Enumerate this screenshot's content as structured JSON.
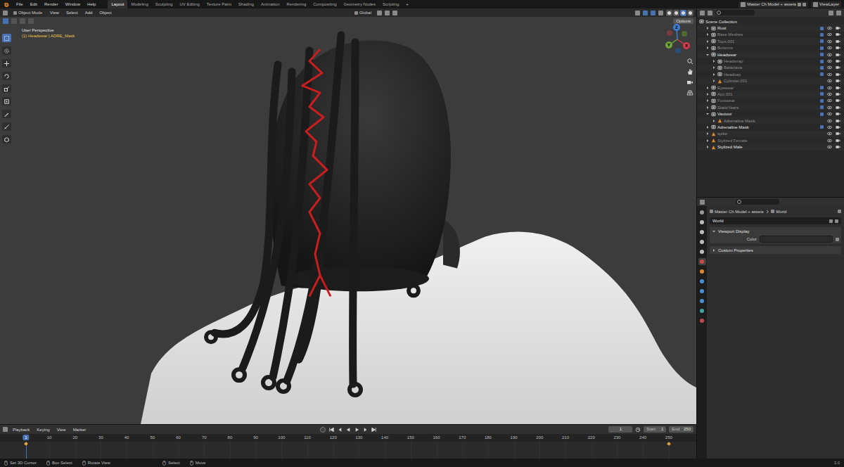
{
  "topbar": {
    "menu": [
      "File",
      "Edit",
      "Render",
      "Window",
      "Help"
    ],
    "workspaces": [
      {
        "label": "Layout",
        "selected": true
      },
      {
        "label": "Modeling",
        "selected": false
      },
      {
        "label": "Sculpting",
        "selected": false
      },
      {
        "label": "UV Editing",
        "selected": false
      },
      {
        "label": "Texture Paint",
        "selected": false
      },
      {
        "label": "Shading",
        "selected": false
      },
      {
        "label": "Animation",
        "selected": false
      },
      {
        "label": "Rendering",
        "selected": false
      },
      {
        "label": "Compositing",
        "selected": false
      },
      {
        "label": "Geometry Nodes",
        "selected": false
      },
      {
        "label": "Scripting",
        "selected": false
      }
    ],
    "add_workspace": "+",
    "scene": "Master Ch Model + assets",
    "view_layer": "ViewLayer"
  },
  "viewport": {
    "mode": "Object Mode",
    "menu": [
      "View",
      "Select",
      "Add",
      "Object"
    ],
    "orientation": "Global",
    "options": "Options",
    "select_modes": [
      {
        "selected": true
      },
      {
        "selected": false
      },
      {
        "selected": false
      },
      {
        "selected": false
      }
    ],
    "tools": [
      {
        "selected": true
      },
      {
        "selected": false
      },
      {
        "selected": false
      },
      {
        "selected": false
      },
      {
        "selected": false
      },
      {
        "selected": false
      },
      {
        "selected": false
      },
      {
        "selected": false
      },
      {
        "selected": false
      }
    ],
    "perspective": "User Perspective",
    "object_info": "(1) Headwear | ADRE_Mask",
    "gizmo": {
      "x": "X",
      "y": "Y",
      "z": "Z"
    },
    "shading": [
      {
        "selected": false
      },
      {
        "selected": false
      },
      {
        "selected": true
      },
      {
        "selected": false
      }
    ]
  },
  "outliner": {
    "items": [
      {
        "name": "Scene Collection",
        "kind": "scene",
        "expanded": true,
        "dimmed": false,
        "children": [
          {
            "name": "Rust",
            "kind": "collection",
            "expanded": false,
            "dimmed": false,
            "checked": true,
            "visible": true,
            "children": []
          },
          {
            "name": "Base Meshes",
            "kind": "collection",
            "expanded": false,
            "dimmed": true,
            "checked": true,
            "visible": true,
            "children": []
          },
          {
            "name": "Tops.001",
            "kind": "collection",
            "expanded": false,
            "dimmed": true,
            "checked": true,
            "visible": true,
            "children": []
          },
          {
            "name": "Bottoms",
            "kind": "collection",
            "expanded": false,
            "dimmed": true,
            "checked": true,
            "visible": true,
            "children": []
          },
          {
            "name": "Headwear",
            "kind": "collection",
            "expanded": true,
            "dimmed": false,
            "checked": true,
            "visible": true,
            "children": [
              {
                "name": "Headwrap",
                "kind": "collection",
                "expanded": false,
                "dimmed": true,
                "checked": true,
                "visible": true,
                "children": []
              },
              {
                "name": "Balaclava",
                "kind": "collection",
                "expanded": false,
                "dimmed": true,
                "checked": true,
                "visible": true,
                "children": []
              },
              {
                "name": "Headcap",
                "kind": "collection",
                "expanded": false,
                "dimmed": true,
                "checked": true,
                "visible": true,
                "children": []
              },
              {
                "name": "Cylinder.001",
                "kind": "object",
                "expanded": false,
                "dimmed": true,
                "visible": true,
                "children": []
              }
            ]
          },
          {
            "name": "Eyewear",
            "kind": "collection",
            "expanded": false,
            "dimmed": true,
            "checked": true,
            "visible": true,
            "children": []
          },
          {
            "name": "Acc.001",
            "kind": "collection",
            "expanded": false,
            "dimmed": true,
            "checked": true,
            "visible": true,
            "children": []
          },
          {
            "name": "Footwear",
            "kind": "collection",
            "expanded": false,
            "dimmed": true,
            "checked": true,
            "visible": true,
            "children": []
          },
          {
            "name": "StaticYears",
            "kind": "collection",
            "expanded": false,
            "dimmed": true,
            "checked": true,
            "visible": true,
            "children": []
          },
          {
            "name": "Vautour",
            "kind": "collection",
            "expanded": true,
            "dimmed": false,
            "checked": true,
            "visible": true,
            "children": [
              {
                "name": "Adrenaline Mask",
                "kind": "object",
                "expanded": false,
                "dimmed": true,
                "visible": true,
                "children": []
              }
            ]
          },
          {
            "name": "Adrenaline Mask",
            "kind": "collection",
            "expanded": false,
            "dimmed": false,
            "checked": true,
            "visible": true,
            "children": []
          },
          {
            "name": "spike",
            "kind": "object",
            "expanded": false,
            "dimmed": true,
            "visible": true,
            "children": []
          },
          {
            "name": "Stylized Female",
            "kind": "object",
            "expanded": false,
            "dimmed": true,
            "visible": true,
            "children": []
          },
          {
            "name": "Stylized Male",
            "kind": "object",
            "expanded": false,
            "dimmed": false,
            "visible": true,
            "children": []
          }
        ]
      }
    ]
  },
  "properties": {
    "tabs": [
      {
        "selected": false,
        "color": "#9a9a9a"
      },
      {
        "selected": false,
        "color": "#bdbdbd"
      },
      {
        "selected": false,
        "color": "#bdbdbd"
      },
      {
        "selected": false,
        "color": "#bdbdbd"
      },
      {
        "selected": false,
        "color": "#bdbdbd"
      },
      {
        "selected": true,
        "color": "#d04a4a"
      },
      {
        "selected": false,
        "color": "#e08a2e"
      },
      {
        "selected": false,
        "color": "#4a8fd6"
      },
      {
        "selected": false,
        "color": "#4a8fd6"
      },
      {
        "selected": false,
        "color": "#4a8fd6"
      },
      {
        "selected": false,
        "color": "#3fa3a3"
      },
      {
        "selected": false,
        "color": "#c04848"
      }
    ],
    "breadcrumb": [
      "Master Ch Model + assets",
      "World"
    ],
    "world": "World",
    "sections": [
      {
        "label": "Viewport Display",
        "expanded": true,
        "fields": [
          {
            "label": "Color",
            "color": "#2b2b2b"
          }
        ]
      },
      {
        "label": "Custom Properties",
        "expanded": false,
        "fields": []
      }
    ]
  },
  "timeline": {
    "menu": [
      "Playback",
      "Keying",
      "View",
      "Marker"
    ],
    "frame": "1",
    "start_label": "Start",
    "start": "1",
    "end_label": "End",
    "end": "250",
    "current": "1",
    "ruler": [
      "10",
      "20",
      "30",
      "40",
      "50",
      "60",
      "70",
      "80",
      "90",
      "100",
      "110",
      "120",
      "130",
      "140",
      "150",
      "160",
      "170",
      "180",
      "190",
      "200",
      "210",
      "220",
      "230",
      "240",
      "250"
    ],
    "keyframes": [
      1,
      250
    ]
  },
  "status_bar": {
    "items": [
      {
        "label": "Set 3D Cursor"
      },
      {
        "label": "Box Select"
      },
      {
        "label": "Rotate View"
      },
      {
        "label": "Select"
      },
      {
        "label": "Move"
      }
    ],
    "version": "3.0"
  }
}
